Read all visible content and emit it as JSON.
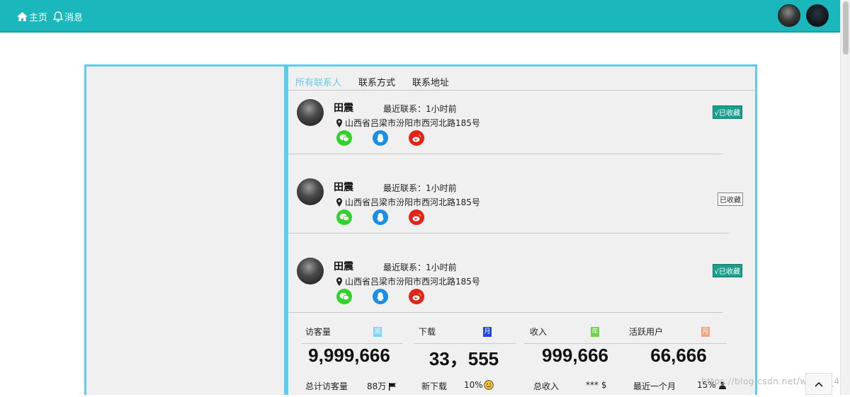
{
  "nav": {
    "home_label": "主页",
    "messages_label": "消息"
  },
  "tabs": [
    {
      "label": "所有联系人",
      "active": true
    },
    {
      "label": "联系方式",
      "active": false
    },
    {
      "label": "联系地址",
      "active": false
    }
  ],
  "contacts": [
    {
      "name": "田震",
      "recent": "最近联系：1小时前",
      "address": "山西省吕梁市汾阳市西河北路185号",
      "favorite_label": "√已收藏",
      "favorited": true
    },
    {
      "name": "田震",
      "recent": "最近联系：1小时前",
      "address": "山西省吕梁市汾阳市西河北路185号",
      "favorite_label": "已收藏",
      "favorited": false
    },
    {
      "name": "田震",
      "recent": "最近联系：1小时前",
      "address": "山西省吕梁市汾阳市西河北路185号",
      "favorite_label": "√已收藏",
      "favorited": true
    }
  ],
  "stats": [
    {
      "title": "访客量",
      "icon_text": "周",
      "icon_color": "#7fd3f2",
      "value": "9,999,666",
      "foot_label": "总计访客量",
      "foot_value": "88万",
      "foot_icon": "flag-icon"
    },
    {
      "title": "下载",
      "icon_text": "月",
      "icon_color": "#2346d8",
      "value": "33，555",
      "foot_label": "新下载",
      "foot_value": "10%",
      "foot_icon": "smile-icon"
    },
    {
      "title": "收入",
      "icon_text": "年",
      "icon_color": "#6fd24a",
      "value": "999,666",
      "foot_label": "总收入",
      "foot_value": "*** $",
      "foot_icon": ""
    },
    {
      "title": "活跃用户",
      "icon_text": "月",
      "icon_color": "#f0a581",
      "value": "66,666",
      "foot_label": "最近一个月",
      "foot_value": "15%",
      "foot_icon": "user-icon"
    }
  ],
  "watermark": "https://blog.csdn.net/weixin_43510622",
  "colors": {
    "topbar": "#1ab8bd",
    "panel_border": "#5bcdf0",
    "active_tab": "#72c7e8",
    "favorite_on": "#1ba08e"
  }
}
